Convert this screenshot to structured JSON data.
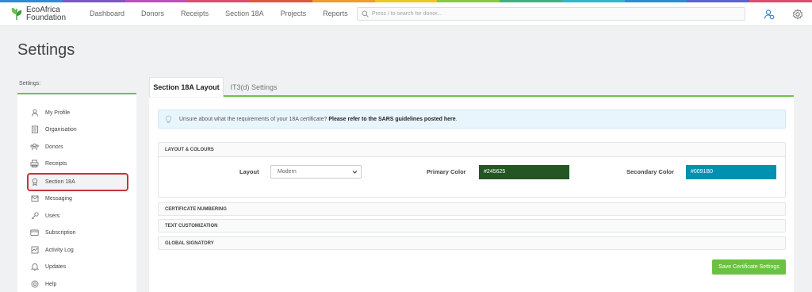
{
  "brand": {
    "line1": "EcoAfrica",
    "line2": "Foundation"
  },
  "nav": [
    "Dashboard",
    "Donors",
    "Receipts",
    "Section 18A",
    "Projects",
    "Reports"
  ],
  "search": {
    "placeholder": "Press / to search for donor..."
  },
  "rainbow_colors": [
    "#2e8bd9",
    "#7b57c9",
    "#c04dbb",
    "#e04b6e",
    "#e2563a",
    "#f29a2e",
    "#f3c623",
    "#8dc63f",
    "#3fb27f",
    "#2fb8c9",
    "#2a8ed4",
    "#5f5fd1",
    "#e04b6e"
  ],
  "page_title": "Settings",
  "sidebar": {
    "heading": "Settings:",
    "items": [
      {
        "label": "My Profile",
        "icon": "user-icon"
      },
      {
        "label": "Organisation",
        "icon": "building-icon"
      },
      {
        "label": "Donors",
        "icon": "donors-icon"
      },
      {
        "label": "Receipts",
        "icon": "receipt-icon"
      },
      {
        "label": "Section 18A",
        "icon": "certificate-icon",
        "active": true
      },
      {
        "label": "Messaging",
        "icon": "envelope-icon"
      },
      {
        "label": "Users",
        "icon": "key-icon"
      },
      {
        "label": "Subscription",
        "icon": "card-icon"
      },
      {
        "label": "Activity Log",
        "icon": "activity-icon"
      },
      {
        "label": "Updates",
        "icon": "bell-icon"
      },
      {
        "label": "Help",
        "icon": "help-icon"
      }
    ]
  },
  "tabs": {
    "active": "Section 18A Layout",
    "inactive": "IT3(d) Settings"
  },
  "info": {
    "text": "Unsure about what the requirements of your 18A certificate?",
    "link": "Please refer to the SARS guidelines posted here",
    "suffix": "."
  },
  "layout_panel": {
    "title": "LAYOUT & COLOURS",
    "layout_label": "Layout",
    "layout_value": "Modern",
    "primary_label": "Primary Color",
    "primary_value": "#245625",
    "secondary_label": "Secondary Color",
    "secondary_value": "#0091B0"
  },
  "sections": [
    "CERTIFICATE NUMBERING",
    "TEXT CUSTOMIZATION",
    "GLOBAL SIGNATORY"
  ],
  "save_label": "Save Certificate Settings",
  "accent": "#6dc24b"
}
